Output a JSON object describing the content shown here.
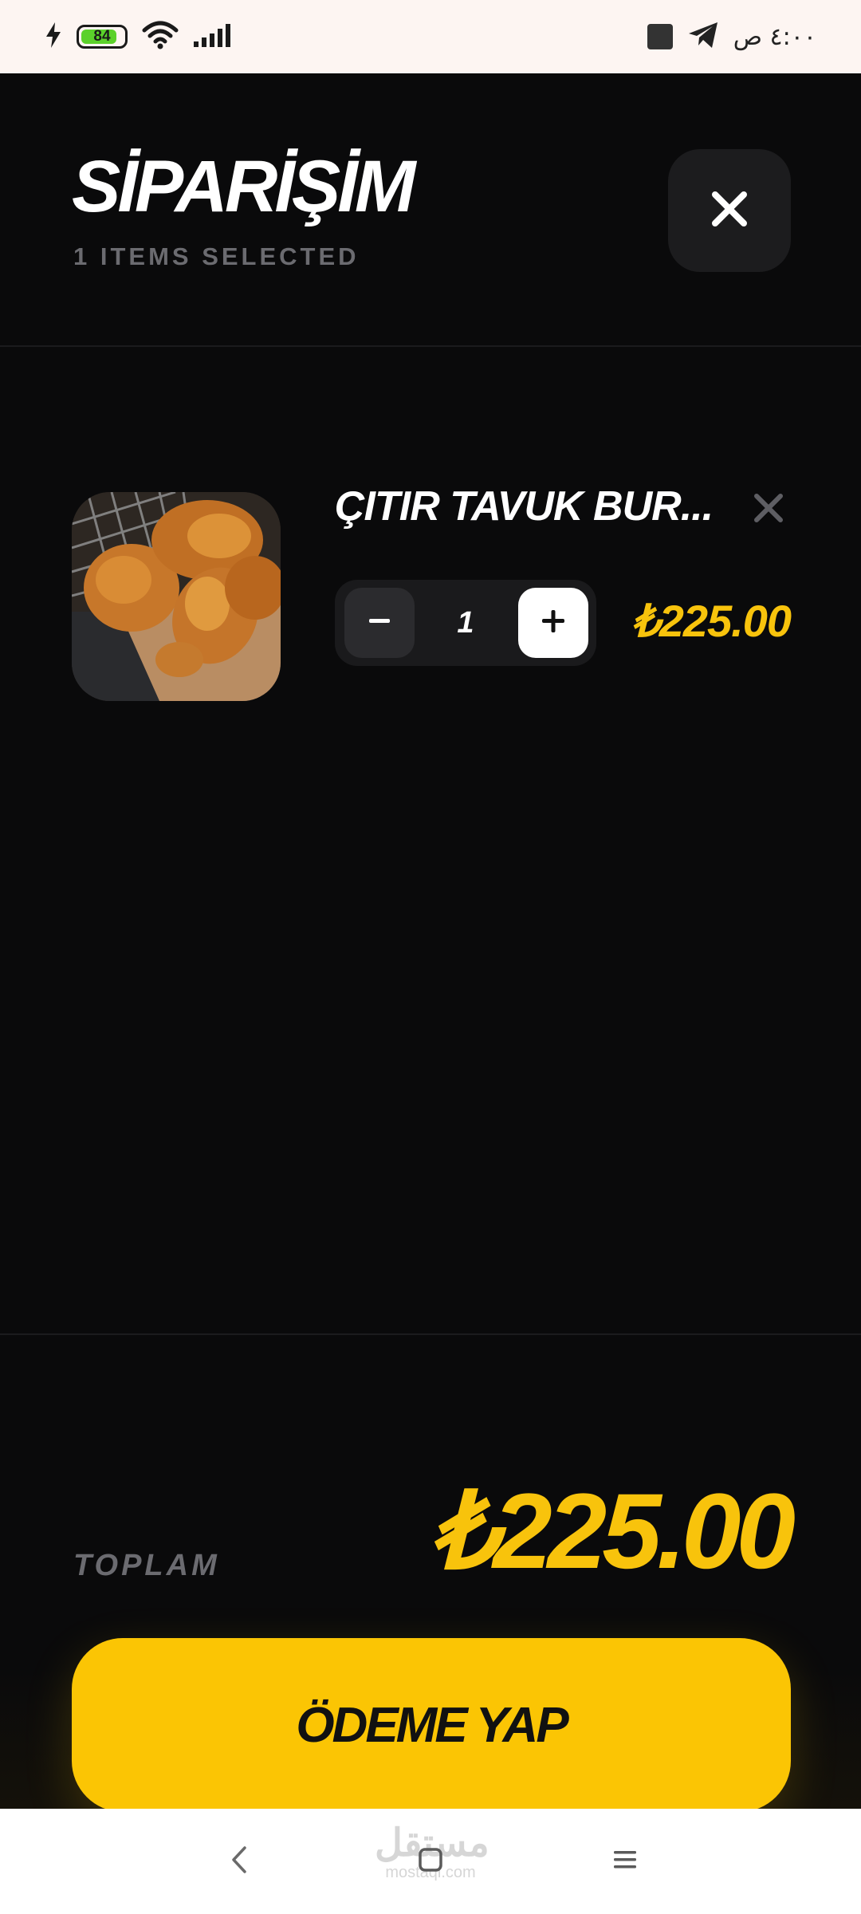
{
  "status_bar": {
    "time": "٤:٠٠ ص",
    "battery_level": "84",
    "battery_fraction": 0.84,
    "icons": [
      "charging-icon",
      "battery-icon",
      "wifi-icon",
      "signal-icon",
      "telegram-icon",
      "stop-icon"
    ]
  },
  "header": {
    "title": "SİPARİŞİM",
    "subtitle": "1 ITEMS SELECTED",
    "close_icon": "close-icon"
  },
  "cart": {
    "items": [
      {
        "name": "ÇITIR TAVUK BUR...",
        "quantity": "1",
        "price": "₺225.00",
        "image": "fried-chicken-photo"
      }
    ]
  },
  "footer": {
    "total_label": "TOPLAM",
    "total_value": "₺225.00",
    "pay_button": "ÖDEME YAP"
  },
  "nav_bar": {
    "watermark_main": "مستقل",
    "watermark_sub": "mostaql.com",
    "icons": [
      "back-icon",
      "home-icon",
      "menu-icon"
    ]
  },
  "colors": {
    "background": "#0a0a0b",
    "accent": "#fbc504",
    "price": "#f8c30c",
    "muted": "#6b6b70",
    "surface": "#1c1c1e"
  }
}
